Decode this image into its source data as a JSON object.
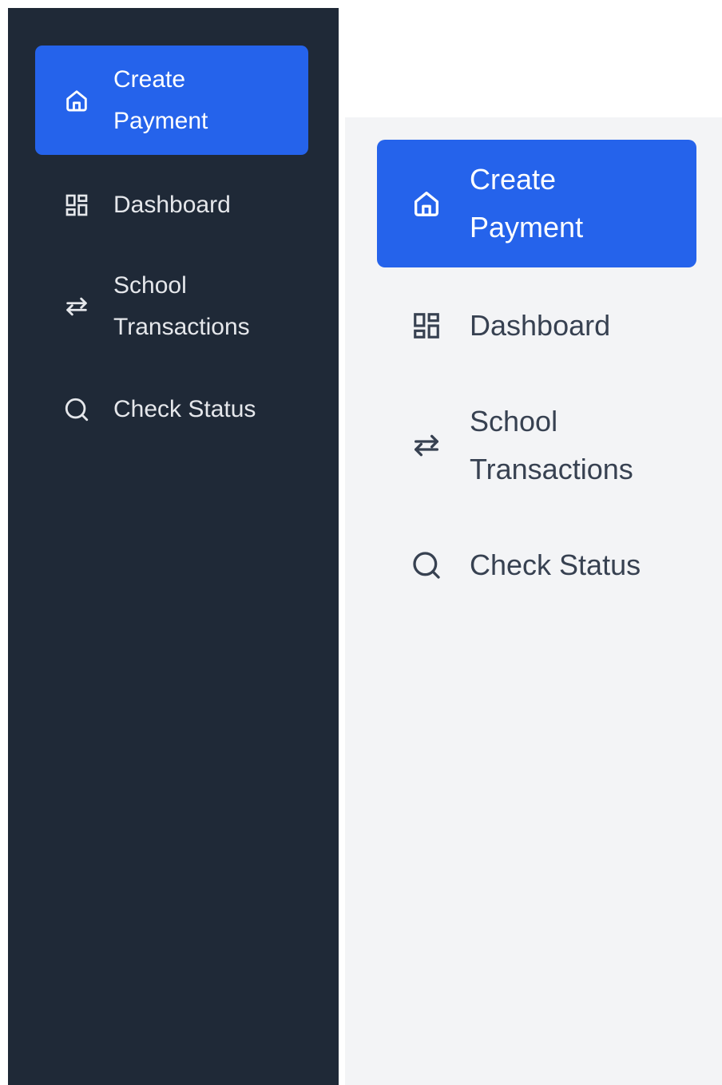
{
  "colors": {
    "dark_sidebar_bg": "#1f2937",
    "light_sidebar_bg": "#f3f4f6",
    "active_bg": "#2563eb",
    "dark_text": "#e5e7eb",
    "light_text": "#374151"
  },
  "dark_sidebar": {
    "items": [
      {
        "label": "Create Payment",
        "icon": "home-icon",
        "active": true
      },
      {
        "label": "Dashboard",
        "icon": "dashboard-grid-icon",
        "active": false
      },
      {
        "label": "School Transactions",
        "icon": "arrows-left-right-icon",
        "active": false
      },
      {
        "label": "Check Status",
        "icon": "search-icon",
        "active": false
      }
    ]
  },
  "light_sidebar": {
    "items": [
      {
        "label": "Create Payment",
        "icon": "home-icon",
        "active": true
      },
      {
        "label": "Dashboard",
        "icon": "dashboard-grid-icon",
        "active": false
      },
      {
        "label": "School Transactions",
        "icon": "arrows-left-right-icon",
        "active": false
      },
      {
        "label": "Check Status",
        "icon": "search-icon",
        "active": false
      }
    ]
  }
}
